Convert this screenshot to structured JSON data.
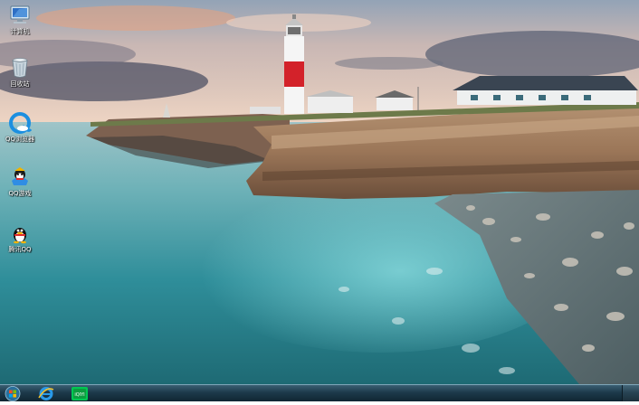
{
  "desktop": {
    "icons": [
      {
        "id": "computer",
        "label": "计算机",
        "icon": "computer-icon"
      },
      {
        "id": "recycle-bin",
        "label": "回收站",
        "icon": "recycle-bin-icon"
      },
      {
        "id": "qq-browser",
        "label": "QQ浏览器",
        "icon": "qq-browser-icon"
      },
      {
        "id": "qq-game",
        "label": "QQ游戏",
        "icon": "qq-game-icon"
      },
      {
        "id": "tencent-qq",
        "label": "腾讯QQ",
        "icon": "tencent-qq-icon"
      }
    ]
  },
  "taskbar": {
    "start_icon": "windows-start-icon",
    "pinned": [
      {
        "id": "ie",
        "icon": "internet-explorer-icon"
      },
      {
        "id": "iqiyi",
        "icon": "iqiyi-icon",
        "text": "iQIYI"
      }
    ]
  },
  "colors": {
    "taskbar_top": "#3a5f73",
    "taskbar_bottom": "#102632",
    "lighthouse_red": "#d3222a",
    "sea": "#2f8e9a"
  }
}
